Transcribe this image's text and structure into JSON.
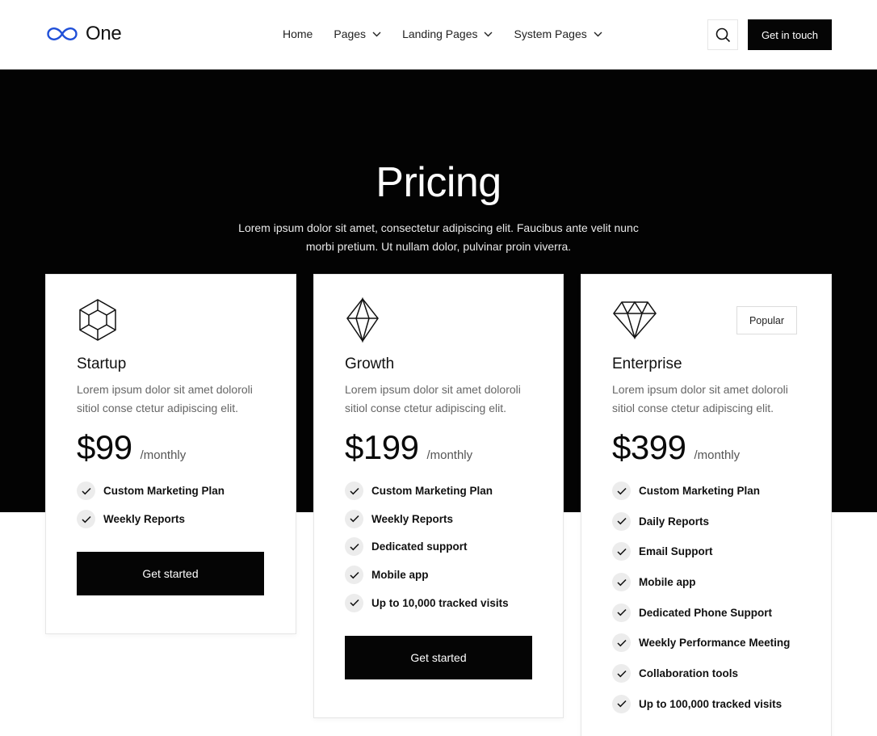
{
  "header": {
    "logo_text": "One",
    "nav": [
      {
        "label": "Home",
        "has_dropdown": false
      },
      {
        "label": "Pages",
        "has_dropdown": true
      },
      {
        "label": "Landing Pages",
        "has_dropdown": true
      },
      {
        "label": "System Pages",
        "has_dropdown": true
      }
    ],
    "search_icon": "search-icon",
    "cta_label": "Get in touch"
  },
  "hero": {
    "title": "Pricing",
    "subtitle_line1": "Lorem ipsum dolor sit amet, consectetur adipiscing elit. Faucibus ante velit nunc",
    "subtitle_line2": "morbi pretium. Ut nullam dolor, pulvinar proin viverra."
  },
  "plans": [
    {
      "icon": "hexagon-gem-icon",
      "name": "Startup",
      "desc_line1": "Lorem ipsum dolor sit amet doloroli",
      "desc_line2": "sitiol conse ctetur adipiscing elit.",
      "price": "$99",
      "period": "/monthly",
      "features": [
        "Custom Marketing Plan",
        "Weekly Reports"
      ],
      "button": "Get started"
    },
    {
      "icon": "crystal-icon",
      "name": "Growth",
      "desc_line1": "Lorem ipsum dolor sit amet doloroli",
      "desc_line2": "sitiol conse ctetur adipiscing elit.",
      "price": "$199",
      "period": "/monthly",
      "features": [
        "Custom Marketing Plan",
        "Weekly Reports",
        "Dedicated support",
        "Mobile app",
        "Up to 10,000 tracked visits"
      ],
      "button": "Get started"
    },
    {
      "icon": "diamond-icon",
      "name": "Enterprise",
      "badge": "Popular",
      "desc_line1": "Lorem ipsum dolor sit amet doloroli",
      "desc_line2": "sitiol conse ctetur adipiscing elit.",
      "price": "$399",
      "period": "/monthly",
      "features": [
        "Custom Marketing Plan",
        "Daily Reports",
        "Email Support",
        "Mobile app",
        "Dedicated Phone Support",
        "Weekly Performance Meeting",
        "Collaboration tools",
        "Up to 100,000 tracked visits"
      ]
    }
  ],
  "colors": {
    "accent": "#1f4fd8",
    "dark": "#030303",
    "check_bg": "#ececec"
  }
}
